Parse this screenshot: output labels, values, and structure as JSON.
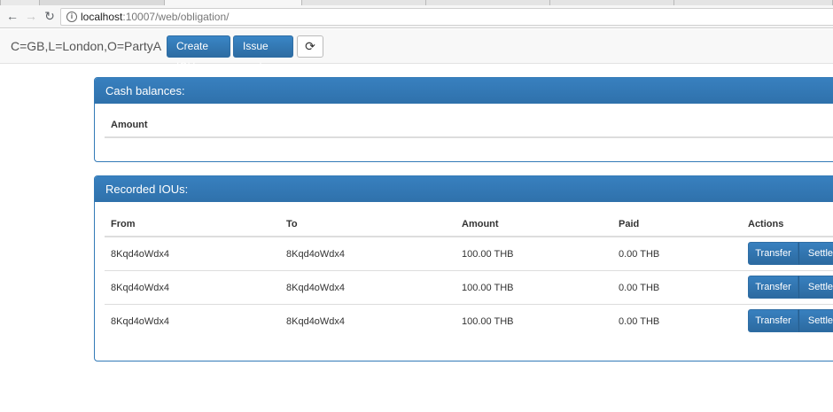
{
  "browser": {
    "url_host": "localhost",
    "url_rest": ":10007/web/obligation/"
  },
  "header": {
    "party": "C=GB,L=London,O=PartyA",
    "create_iou_label": "Create IOU",
    "issue_cash_label": "Issue cash",
    "refresh_icon": "refresh-icon"
  },
  "cash_panel": {
    "title": "Cash balances:",
    "column_amount": "Amount"
  },
  "ious_panel": {
    "title": "Recorded IOUs:",
    "columns": {
      "from": "From",
      "to": "To",
      "amount": "Amount",
      "paid": "Paid",
      "actions": "Actions"
    },
    "rows": [
      {
        "from": "8Kqd4oWdx4",
        "to": "8Kqd4oWdx4",
        "amount": "100.00 THB",
        "paid": "0.00 THB",
        "transfer": "Transfer",
        "settle": "Settle"
      },
      {
        "from": "8Kqd4oWdx4",
        "to": "8Kqd4oWdx4",
        "amount": "100.00 THB",
        "paid": "0.00 THB",
        "transfer": "Transfer",
        "settle": "Settle"
      },
      {
        "from": "8Kqd4oWdx4",
        "to": "8Kqd4oWdx4",
        "amount": "100.00 THB",
        "paid": "0.00 THB",
        "transfer": "Transfer",
        "settle": "Settle"
      }
    ]
  },
  "colors": {
    "primary": "#337ab7",
    "primary_border": "#2e6da4"
  }
}
